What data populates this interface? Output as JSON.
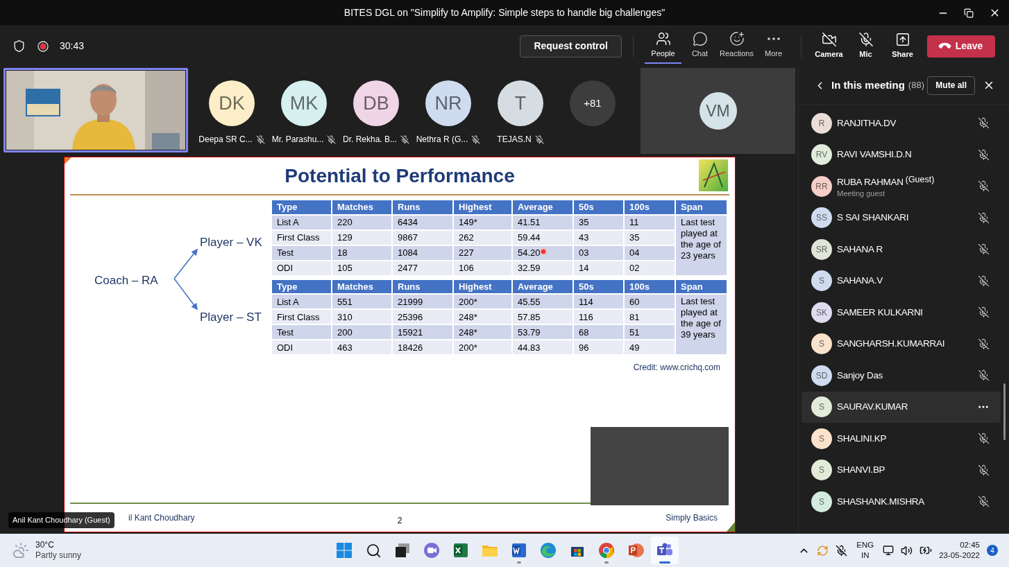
{
  "window": {
    "title": "BITES DGL on \"Simplify to Amplify: Simple steps to handle big challenges\""
  },
  "toolbar": {
    "timer": "30:43",
    "request_control": "Request control",
    "items": [
      {
        "kind": "people",
        "label": "People",
        "selected": true
      },
      {
        "kind": "chat",
        "label": "Chat",
        "selected": false
      },
      {
        "kind": "reactions",
        "label": "Reactions",
        "selected": false
      },
      {
        "kind": "more",
        "label": "More",
        "selected": false
      }
    ],
    "media": [
      {
        "kind": "camera",
        "label": "Camera",
        "on": false
      },
      {
        "kind": "mic",
        "label": "Mic",
        "on": false
      },
      {
        "kind": "share",
        "label": "Share"
      }
    ],
    "leave": "Leave"
  },
  "strip": {
    "participants": [
      {
        "initials": "DK",
        "name": "Deepa SR C...",
        "color": "#fbeec8",
        "muted": true
      },
      {
        "initials": "MK",
        "name": "Mr. Parashu...",
        "color": "#d6efef",
        "muted": true
      },
      {
        "initials": "DB",
        "name": "Dr. Rekha. B...",
        "color": "#efd5e5",
        "muted": true
      },
      {
        "initials": "NR",
        "name": "Nethra R (G...",
        "color": "#cfdcef",
        "muted": true
      },
      {
        "initials": "T",
        "name": "TEJAS.N",
        "color": "#d5dde2",
        "muted": true
      }
    ],
    "overflow": "+81",
    "tile": {
      "initials": "VM",
      "color": "#d5e3e8"
    }
  },
  "presenter_label": "Anil Kant Choudhary (Guest)",
  "slide": {
    "title": "Potential to Performance",
    "diagram": {
      "coach": "Coach – RA",
      "players": [
        "Player – VK",
        "Player – ST"
      ]
    },
    "tables": [
      {
        "columns": [
          "Type",
          "Matches",
          "Runs",
          "Highest",
          "Average",
          "50s",
          "100s",
          "Span"
        ],
        "rows": [
          [
            "List A",
            "220",
            "6434",
            "149*",
            "41.51",
            "35",
            "11"
          ],
          [
            "First Class",
            "129",
            "9867",
            "262",
            "59.44",
            "43",
            "35"
          ],
          [
            "Test",
            "18",
            "1084",
            "227",
            "54.20",
            "03",
            "04"
          ],
          [
            "ODI",
            "105",
            "2477",
            "106",
            "32.59",
            "14",
            "02"
          ]
        ],
        "span": "Last test played at the age of 23 years"
      },
      {
        "columns": [
          "Type",
          "Matches",
          "Runs",
          "Highest",
          "Average",
          "50s",
          "100s",
          "Span"
        ],
        "rows": [
          [
            "List A",
            "551",
            "21999",
            "200*",
            "45.55",
            "114",
            "60"
          ],
          [
            "First Class",
            "310",
            "25396",
            "248*",
            "57.85",
            "116",
            "81"
          ],
          [
            "Test",
            "200",
            "15921",
            "248*",
            "53.79",
            "68",
            "51"
          ],
          [
            "ODI",
            "463",
            "18426",
            "200*",
            "44.83",
            "96",
            "49"
          ]
        ],
        "span": "Last test played at the age of 39 years"
      }
    ],
    "credit": "Credit: www.crichq.com",
    "footer_left": "il Kant Choudhary",
    "page": "2",
    "footer_right": "Simply Basics"
  },
  "panel": {
    "title": "In this meeting",
    "count": "(88)",
    "mute_all": "Mute all",
    "people": [
      {
        "initials": "R",
        "name": "RANJITHA.DV",
        "color": "#ebdcd7",
        "selected": false
      },
      {
        "initials": "RV",
        "name": "RAVI VAMSHI.D.N",
        "color": "#e1eddc",
        "selected": false
      },
      {
        "initials": "RR",
        "name": "RUBA RAHMAN",
        "tag": "(Guest)",
        "subtitle": "Meeting guest",
        "color": "#f4cfc8",
        "selected": false
      },
      {
        "initials": "SS",
        "name": "S SAI SHANKARI",
        "color": "#cfdcef",
        "selected": false
      },
      {
        "initials": "SR",
        "name": "SAHANA R",
        "color": "#dfe6d8",
        "selected": false
      },
      {
        "initials": "S",
        "name": "SAHANA.V",
        "color": "#cfdcef",
        "selected": false
      },
      {
        "initials": "SK",
        "name": "SAMEER KULKARNI",
        "color": "#e0dcef",
        "selected": false
      },
      {
        "initials": "S",
        "name": "SANGHARSH.KUMARRAI",
        "color": "#fbe2cc",
        "selected": false
      },
      {
        "initials": "SD",
        "name": "Sanjoy Das",
        "color": "#cfdcef",
        "selected": false
      },
      {
        "initials": "S",
        "name": "SAURAV.KUMAR",
        "color": "#e2ebd8",
        "selected": true
      },
      {
        "initials": "S",
        "name": "SHALINI.KP",
        "color": "#fbe2cc",
        "selected": false
      },
      {
        "initials": "S",
        "name": "SHANVI.BP",
        "color": "#e2ebd8",
        "selected": false
      },
      {
        "initials": "S",
        "name": "SHASHANK.MISHRA",
        "color": "#d4ecdf",
        "selected": false
      }
    ]
  },
  "taskbar": {
    "weather": {
      "temp": "30°C",
      "desc": "Partly sunny"
    },
    "apps": [
      {
        "kind": "start",
        "running": false,
        "active": false
      },
      {
        "kind": "search",
        "running": false,
        "active": false
      },
      {
        "kind": "taskview",
        "running": false,
        "active": false
      },
      {
        "kind": "meet",
        "running": false,
        "active": false
      },
      {
        "kind": "excel",
        "running": false,
        "active": false
      },
      {
        "kind": "files",
        "running": false,
        "active": false
      },
      {
        "kind": "word",
        "running": true,
        "active": false
      },
      {
        "kind": "edge",
        "running": false,
        "active": false
      },
      {
        "kind": "store",
        "running": false,
        "active": false
      },
      {
        "kind": "chrome",
        "running": true,
        "active": false
      },
      {
        "kind": "powerpoint",
        "running": false,
        "active": false
      },
      {
        "kind": "teams",
        "running": true,
        "active": true
      }
    ],
    "lang": "ENG",
    "region": "IN",
    "time": "02:45",
    "date": "23-05-2022",
    "notifications": "4"
  }
}
